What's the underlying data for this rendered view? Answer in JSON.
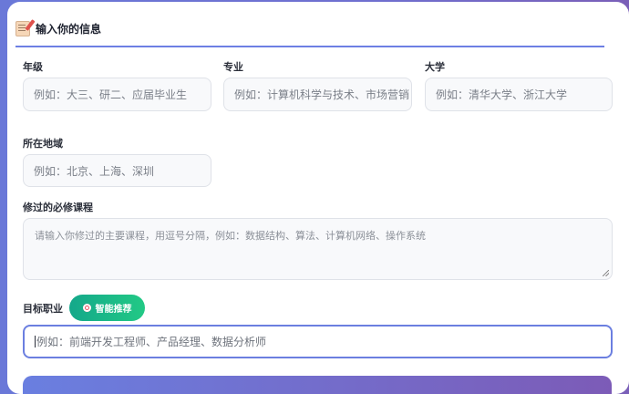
{
  "section": {
    "title": "输入你的信息",
    "icon": "memo-icon"
  },
  "fields": {
    "grade": {
      "label": "年级",
      "placeholder": "例如：大三、研二、应届毕业生"
    },
    "major": {
      "label": "专业",
      "placeholder": "例如：计算机科学与技术、市场营销"
    },
    "university": {
      "label": "大学",
      "placeholder": "例如：清华大学、浙江大学"
    },
    "region": {
      "label": "所在地域",
      "placeholder": "例如：北京、上海、深圳"
    },
    "courses": {
      "label": "修过的必修课程",
      "placeholder": "请输入你修过的主要课程，用逗号分隔，例如：数据结构、算法、计算机网络、操作系统"
    },
    "target_job": {
      "label": "目标职业",
      "placeholder": "例如：前端开发工程师、产品经理、数据分析师"
    }
  },
  "recommend_button": {
    "label": "智能推荐",
    "icon": "target-icon"
  },
  "colors": {
    "accent": "#6b7fe0",
    "recommend": "#1db988",
    "background": "#6a78d8"
  }
}
